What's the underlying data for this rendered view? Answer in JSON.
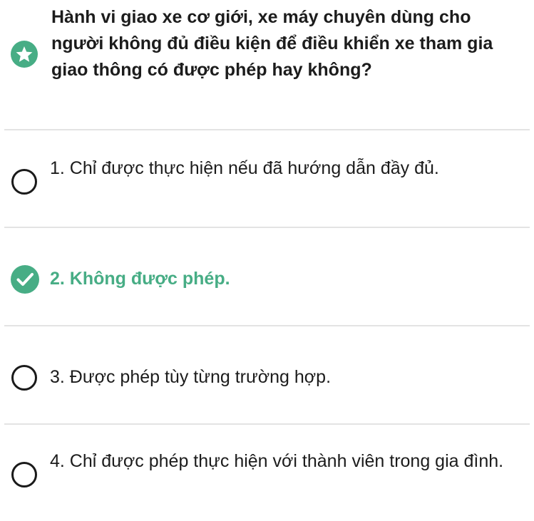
{
  "question": {
    "icon": "star-icon",
    "text": "Hành vi giao xe cơ giới, xe máy chuyên dùng cho người không đủ điều kiện để điều khiển xe tham gia giao thông có được phép hay không?"
  },
  "options": [
    {
      "label": "1. Chỉ được thực hiện nếu đã hướng dẫn đầy đủ.",
      "selected": false
    },
    {
      "label": "2. Không được phép.",
      "selected": true
    },
    {
      "label": "3. Được phép tùy từng trường hợp.",
      "selected": false
    },
    {
      "label": "4. Chỉ được phép thực hiện với thành viên trong gia đình.",
      "selected": false
    }
  ],
  "colors": {
    "accent": "#47ad85",
    "text": "#1c1c1c",
    "divider": "#e3e3e3"
  }
}
